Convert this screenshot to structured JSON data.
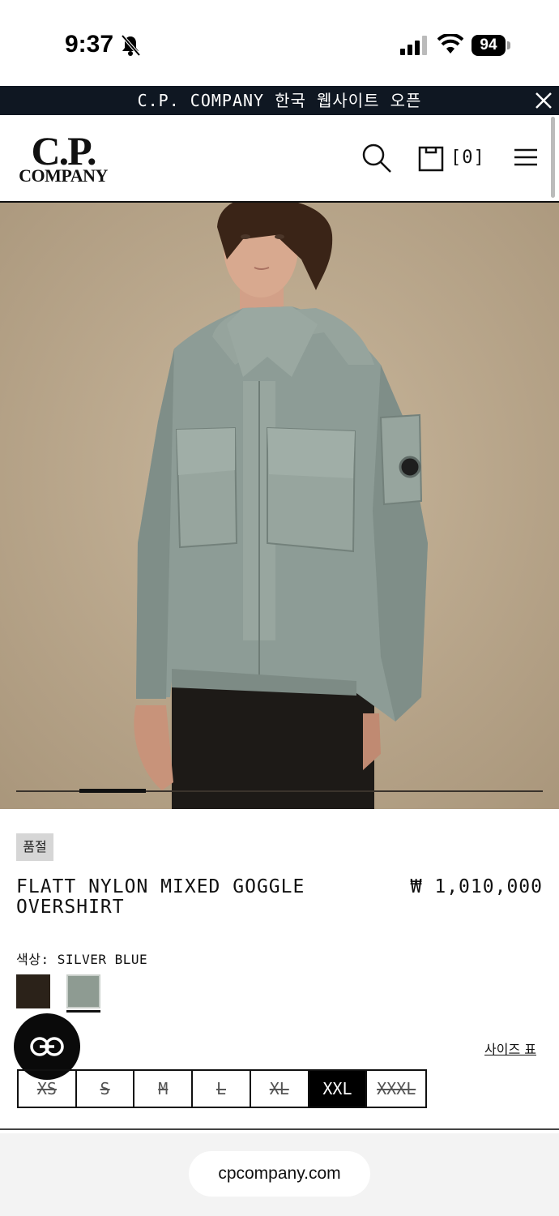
{
  "status_bar": {
    "time": "9:37",
    "battery": "94",
    "icons": [
      "bell-slash-icon",
      "signal-icon",
      "wifi-icon",
      "battery-icon"
    ]
  },
  "announcement": {
    "text": "C.P. COMPANY 한국 웹사이트 오픈",
    "close_icon": "close-icon"
  },
  "header": {
    "logo_line1": "C.P.",
    "logo_line2": "COMPANY",
    "bag_count": "[0]",
    "icons": [
      "search-icon",
      "shopping-bag-icon",
      "menu-icon"
    ]
  },
  "gallery": {
    "slide_index": 2,
    "slide_count": 8
  },
  "product": {
    "badge": "품절",
    "name": "FLATT NYLON MIXED GOGGLE OVERSHIRT",
    "price": "₩ 1,010,000",
    "color_label": "색상: SILVER BLUE",
    "swatches": [
      {
        "name": "dark",
        "color": "#2b2219",
        "selected": false
      },
      {
        "name": "silver-blue",
        "color": "#8e9b92",
        "selected": true
      }
    ],
    "size_chart_label": "사이즈 표",
    "sizes": [
      {
        "label": "XS",
        "available": false,
        "selected": false
      },
      {
        "label": "S",
        "available": false,
        "selected": false
      },
      {
        "label": "M",
        "available": false,
        "selected": false
      },
      {
        "label": "L",
        "available": false,
        "selected": false
      },
      {
        "label": "XL",
        "available": false,
        "selected": false
      },
      {
        "label": "XXL",
        "available": true,
        "selected": true
      },
      {
        "label": "XXXL",
        "available": false,
        "selected": false
      }
    ]
  },
  "chat_widget": {
    "icon": "chat-logo-icon"
  },
  "browser": {
    "url": "cpcompany.com"
  },
  "colors": {
    "announcement_bg": "#0f1722",
    "hero_bg": "#b9a78d",
    "badge_bg": "#d6d6d6",
    "selected_size_bg": "#000000"
  }
}
